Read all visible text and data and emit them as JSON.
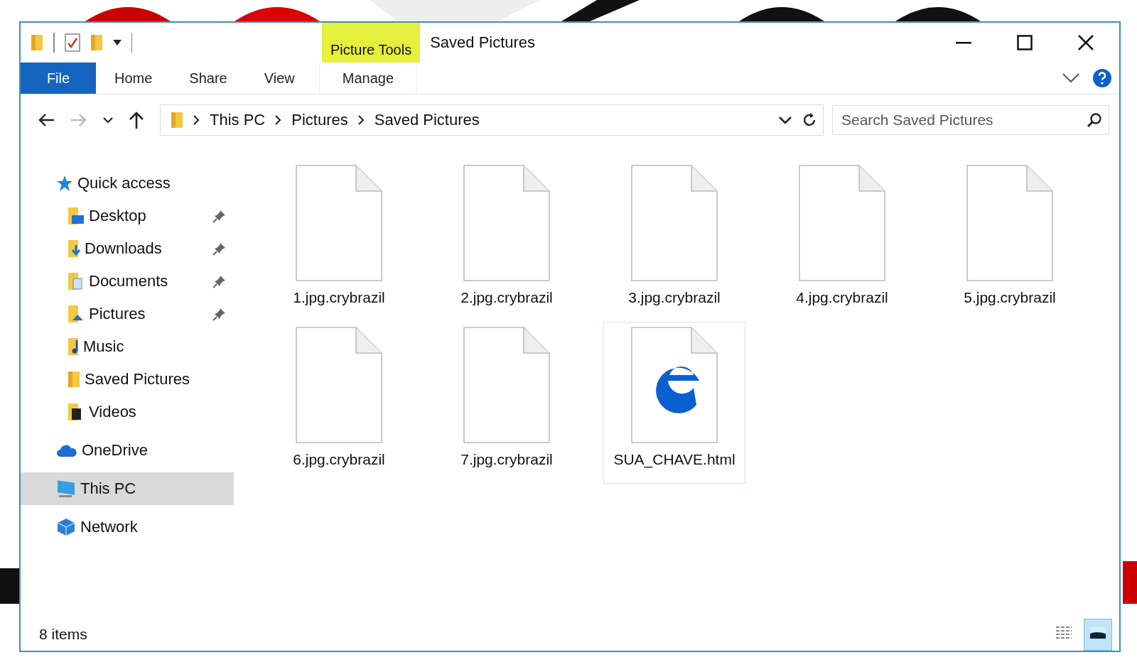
{
  "window": {
    "title": "Saved Pictures",
    "context_group": "Picture Tools"
  },
  "quick_access_toolbar": [
    {
      "kind": "folder"
    },
    {
      "kind": "properties"
    },
    {
      "kind": "new-folder"
    },
    {
      "kind": "dropdown"
    }
  ],
  "ribbon_tabs": [
    {
      "label": "File",
      "kind": "file",
      "selected": false
    },
    {
      "label": "Home",
      "kind": "tab",
      "selected": false
    },
    {
      "label": "Share",
      "kind": "tab",
      "selected": false
    },
    {
      "label": "View",
      "kind": "tab",
      "selected": false
    },
    {
      "label": "Manage",
      "kind": "contextual",
      "selected": false
    }
  ],
  "address_bar": {
    "path": [
      "This PC",
      "Pictures",
      "Saved Pictures"
    ]
  },
  "search": {
    "placeholder": "Search Saved Pictures"
  },
  "sidebar": {
    "items": [
      {
        "label": "Quick access",
        "kind": "star",
        "selected": false,
        "children": [
          {
            "label": "Desktop",
            "kind": "desktop",
            "pinned": true,
            "selected": false
          },
          {
            "label": "Downloads",
            "kind": "downloads",
            "pinned": true,
            "selected": false
          },
          {
            "label": "Documents",
            "kind": "documents",
            "pinned": true,
            "selected": false
          },
          {
            "label": "Pictures",
            "kind": "pictures",
            "pinned": true,
            "selected": false
          },
          {
            "label": "Music",
            "kind": "music",
            "pinned": false,
            "selected": false
          },
          {
            "label": "Saved Pictures",
            "kind": "folder",
            "pinned": false,
            "selected": false
          },
          {
            "label": "Videos",
            "kind": "videos",
            "pinned": false,
            "selected": false
          }
        ]
      },
      {
        "label": "OneDrive",
        "kind": "cloud",
        "selected": false
      },
      {
        "label": "This PC",
        "kind": "pc",
        "selected": true
      },
      {
        "label": "Network",
        "kind": "network",
        "selected": false
      }
    ]
  },
  "files": [
    {
      "name": "1.jpg.crybrazil",
      "kind": "blank",
      "selected": false
    },
    {
      "name": "2.jpg.crybrazil",
      "kind": "blank",
      "selected": false
    },
    {
      "name": "3.jpg.crybrazil",
      "kind": "blank",
      "selected": false
    },
    {
      "name": "4.jpg.crybrazil",
      "kind": "blank",
      "selected": false
    },
    {
      "name": "5.jpg.crybrazil",
      "kind": "blank",
      "selected": false
    },
    {
      "name": "6.jpg.crybrazil",
      "kind": "blank",
      "selected": false
    },
    {
      "name": "7.jpg.crybrazil",
      "kind": "blank",
      "selected": false
    },
    {
      "name": "SUA_CHAVE.html",
      "kind": "web",
      "selected": true
    }
  ],
  "status_bar": {
    "count": "8 items",
    "views": [
      {
        "kind": "details",
        "selected": false
      },
      {
        "kind": "large-icons",
        "selected": true
      }
    ]
  }
}
